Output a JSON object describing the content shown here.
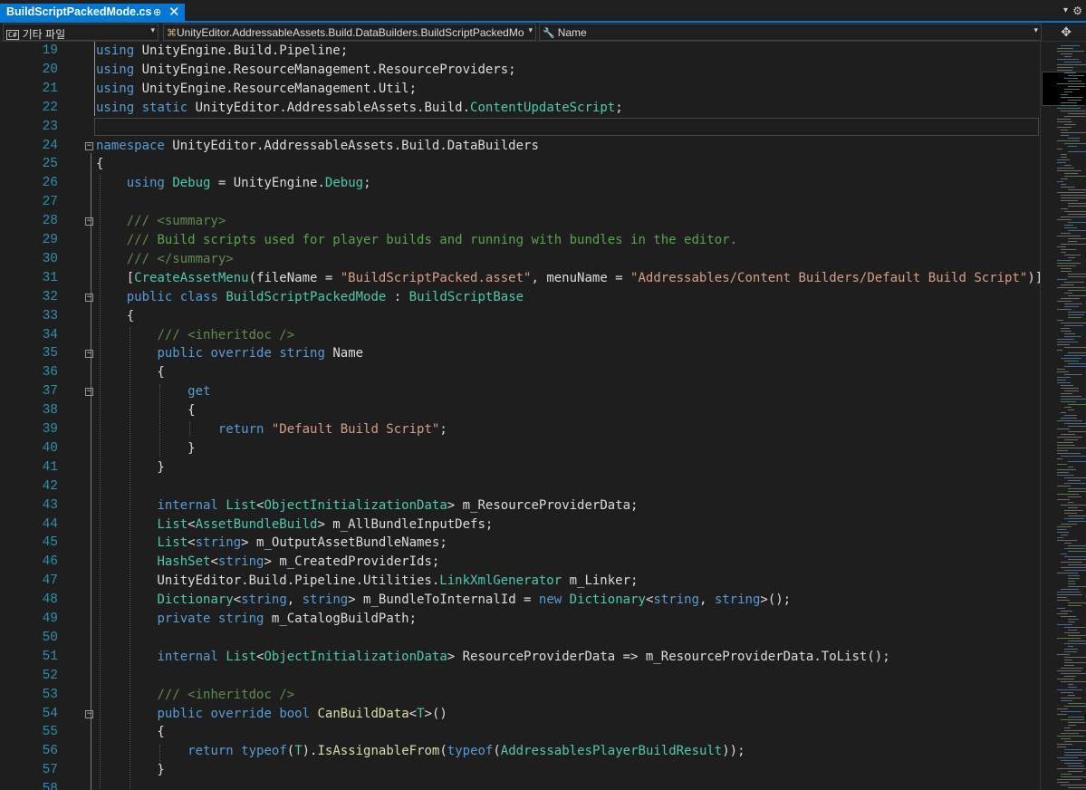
{
  "tab": {
    "title": "BuildScriptPackedMode.cs",
    "pin_glyph": "⊕",
    "close_glyph": "✕"
  },
  "navbar": {
    "project": "기타 파일",
    "project_badge": "C#",
    "type_path": "UnityEditor.AddressableAssets.Build.DataBuilders.BuildScriptPackedMo",
    "member": "Name"
  },
  "colors": {
    "background": "#1e1e1e",
    "keyword": "#569cd6",
    "type": "#4ec9b0",
    "string": "#d69d85",
    "comment": "#57a64a",
    "line_number": "#2b91af",
    "accent": "#0078d4"
  },
  "lines": [
    {
      "n": "19",
      "tokens": [
        [
          "kw",
          "using"
        ],
        [
          "pl",
          " UnityEngine.Build.Pipeline;"
        ]
      ]
    },
    {
      "n": "20",
      "tokens": [
        [
          "kw",
          "using"
        ],
        [
          "pl",
          " UnityEngine.ResourceManagement.ResourceProviders;"
        ]
      ]
    },
    {
      "n": "21",
      "tokens": [
        [
          "kw",
          "using"
        ],
        [
          "pl",
          " UnityEngine.ResourceManagement.Util;"
        ]
      ]
    },
    {
      "n": "22",
      "tokens": [
        [
          "kw",
          "using"
        ],
        [
          "pl",
          " "
        ],
        [
          "kw",
          "static"
        ],
        [
          "pl",
          " UnityEditor.AddressableAssets.Build."
        ],
        [
          "ty",
          "ContentUpdateScript"
        ],
        [
          "pl",
          ";"
        ]
      ]
    },
    {
      "n": "23",
      "tokens": []
    },
    {
      "n": "24",
      "fold": true,
      "tokens": [
        [
          "kw",
          "namespace"
        ],
        [
          "pl",
          " UnityEditor.AddressableAssets.Build.DataBuilders"
        ]
      ]
    },
    {
      "n": "25",
      "tokens": [
        [
          "pl",
          "{"
        ]
      ]
    },
    {
      "n": "26",
      "tokens": [
        [
          "pl",
          "    "
        ],
        [
          "kw",
          "using"
        ],
        [
          "pl",
          " "
        ],
        [
          "ty",
          "Debug"
        ],
        [
          "pl",
          " = UnityEngine."
        ],
        [
          "ty",
          "Debug"
        ],
        [
          "pl",
          ";"
        ]
      ]
    },
    {
      "n": "27",
      "tokens": []
    },
    {
      "n": "28",
      "fold": true,
      "tokens": [
        [
          "pl",
          "    "
        ],
        [
          "cmx",
          "/// <summary>"
        ]
      ]
    },
    {
      "n": "29",
      "tokens": [
        [
          "pl",
          "    "
        ],
        [
          "cmx",
          "/// "
        ],
        [
          "cm",
          "Build scripts used for player builds and running with bundles in the editor."
        ]
      ]
    },
    {
      "n": "30",
      "tokens": [
        [
          "pl",
          "    "
        ],
        [
          "cmx",
          "/// </summary>"
        ]
      ]
    },
    {
      "n": "31",
      "tokens": [
        [
          "pl",
          "    ["
        ],
        [
          "ty",
          "CreateAssetMenu"
        ],
        [
          "pl",
          "(fileName = "
        ],
        [
          "str",
          "\"BuildScriptPacked.asset\""
        ],
        [
          "pl",
          ", menuName = "
        ],
        [
          "str",
          "\"Addressables/Content Builders/Default Build Script\""
        ],
        [
          "pl",
          ")]"
        ]
      ]
    },
    {
      "n": "32",
      "fold": true,
      "tokens": [
        [
          "pl",
          "    "
        ],
        [
          "kw",
          "public"
        ],
        [
          "pl",
          " "
        ],
        [
          "kw",
          "class"
        ],
        [
          "pl",
          " "
        ],
        [
          "ty",
          "BuildScriptPackedMode"
        ],
        [
          "pl",
          " : "
        ],
        [
          "ty",
          "BuildScriptBase"
        ]
      ]
    },
    {
      "n": "33",
      "tokens": [
        [
          "pl",
          "    {"
        ]
      ]
    },
    {
      "n": "34",
      "tokens": [
        [
          "pl",
          "        "
        ],
        [
          "cmx",
          "/// <inheritdoc />"
        ]
      ]
    },
    {
      "n": "35",
      "fold": true,
      "tokens": [
        [
          "pl",
          "        "
        ],
        [
          "kw",
          "public"
        ],
        [
          "pl",
          " "
        ],
        [
          "kw",
          "override"
        ],
        [
          "pl",
          " "
        ],
        [
          "kw",
          "string"
        ],
        [
          "pl",
          " Name"
        ]
      ]
    },
    {
      "n": "36",
      "tokens": [
        [
          "pl",
          "        {"
        ]
      ]
    },
    {
      "n": "37",
      "fold": true,
      "tokens": [
        [
          "pl",
          "            "
        ],
        [
          "kw",
          "get"
        ]
      ]
    },
    {
      "n": "38",
      "tokens": [
        [
          "pl",
          "            {"
        ]
      ]
    },
    {
      "n": "39",
      "tokens": [
        [
          "pl",
          "                "
        ],
        [
          "kw",
          "return"
        ],
        [
          "pl",
          " "
        ],
        [
          "str",
          "\"Default Build Script\""
        ],
        [
          "pl",
          ";"
        ]
      ]
    },
    {
      "n": "40",
      "tokens": [
        [
          "pl",
          "            }"
        ]
      ]
    },
    {
      "n": "41",
      "tokens": [
        [
          "pl",
          "        }"
        ]
      ]
    },
    {
      "n": "42",
      "tokens": []
    },
    {
      "n": "43",
      "tokens": [
        [
          "pl",
          "        "
        ],
        [
          "kw",
          "internal"
        ],
        [
          "pl",
          " "
        ],
        [
          "ty",
          "List"
        ],
        [
          "pl",
          "<"
        ],
        [
          "ty",
          "ObjectInitializationData"
        ],
        [
          "pl",
          "> m_ResourceProviderData;"
        ]
      ]
    },
    {
      "n": "44",
      "tokens": [
        [
          "pl",
          "        "
        ],
        [
          "ty",
          "List"
        ],
        [
          "pl",
          "<"
        ],
        [
          "ty",
          "AssetBundleBuild"
        ],
        [
          "pl",
          "> m_AllBundleInputDefs;"
        ]
      ]
    },
    {
      "n": "45",
      "tokens": [
        [
          "pl",
          "        "
        ],
        [
          "ty",
          "List"
        ],
        [
          "pl",
          "<"
        ],
        [
          "kw",
          "string"
        ],
        [
          "pl",
          "> m_OutputAssetBundleNames;"
        ]
      ]
    },
    {
      "n": "46",
      "tokens": [
        [
          "pl",
          "        "
        ],
        [
          "ty",
          "HashSet"
        ],
        [
          "pl",
          "<"
        ],
        [
          "kw",
          "string"
        ],
        [
          "pl",
          "> m_CreatedProviderIds;"
        ]
      ]
    },
    {
      "n": "47",
      "tokens": [
        [
          "pl",
          "        UnityEditor.Build.Pipeline.Utilities."
        ],
        [
          "ty",
          "LinkXmlGenerator"
        ],
        [
          "pl",
          " m_Linker;"
        ]
      ]
    },
    {
      "n": "48",
      "tokens": [
        [
          "pl",
          "        "
        ],
        [
          "ty",
          "Dictionary"
        ],
        [
          "pl",
          "<"
        ],
        [
          "kw",
          "string"
        ],
        [
          "pl",
          ", "
        ],
        [
          "kw",
          "string"
        ],
        [
          "pl",
          "> m_BundleToInternalId = "
        ],
        [
          "kw",
          "new"
        ],
        [
          "pl",
          " "
        ],
        [
          "ty",
          "Dictionary"
        ],
        [
          "pl",
          "<"
        ],
        [
          "kw",
          "string"
        ],
        [
          "pl",
          ", "
        ],
        [
          "kw",
          "string"
        ],
        [
          "pl",
          ">();"
        ]
      ]
    },
    {
      "n": "49",
      "tokens": [
        [
          "pl",
          "        "
        ],
        [
          "kw",
          "private"
        ],
        [
          "pl",
          " "
        ],
        [
          "kw",
          "string"
        ],
        [
          "pl",
          " m_CatalogBuildPath;"
        ]
      ]
    },
    {
      "n": "50",
      "tokens": []
    },
    {
      "n": "51",
      "tokens": [
        [
          "pl",
          "        "
        ],
        [
          "kw",
          "internal"
        ],
        [
          "pl",
          " "
        ],
        [
          "ty",
          "List"
        ],
        [
          "pl",
          "<"
        ],
        [
          "ty",
          "ObjectInitializationData"
        ],
        [
          "pl",
          "> ResourceProviderData => m_ResourceProviderData.ToList();"
        ]
      ]
    },
    {
      "n": "52",
      "tokens": []
    },
    {
      "n": "53",
      "tokens": [
        [
          "pl",
          "        "
        ],
        [
          "cmx",
          "/// <inheritdoc />"
        ]
      ]
    },
    {
      "n": "54",
      "fold": true,
      "tokens": [
        [
          "pl",
          "        "
        ],
        [
          "kw",
          "public"
        ],
        [
          "pl",
          " "
        ],
        [
          "kw",
          "override"
        ],
        [
          "pl",
          " "
        ],
        [
          "kw",
          "bool"
        ],
        [
          "pl",
          " "
        ],
        [
          "fn",
          "CanBuildData"
        ],
        [
          "pl",
          "<"
        ],
        [
          "ty",
          "T"
        ],
        [
          "pl",
          ">()"
        ]
      ]
    },
    {
      "n": "55",
      "tokens": [
        [
          "pl",
          "        {"
        ]
      ]
    },
    {
      "n": "56",
      "tokens": [
        [
          "pl",
          "            "
        ],
        [
          "kw",
          "return"
        ],
        [
          "pl",
          " "
        ],
        [
          "kw",
          "typeof"
        ],
        [
          "pl",
          "("
        ],
        [
          "ty",
          "T"
        ],
        [
          "pl",
          ")."
        ],
        [
          "fn",
          "IsAssignableFrom"
        ],
        [
          "pl",
          "("
        ],
        [
          "kw",
          "typeof"
        ],
        [
          "pl",
          "("
        ],
        [
          "ty",
          "AddressablesPlayerBuildResult"
        ],
        [
          "pl",
          "));"
        ]
      ]
    },
    {
      "n": "57",
      "tokens": [
        [
          "pl",
          "        }"
        ]
      ]
    },
    {
      "n": "58",
      "tokens": []
    }
  ]
}
